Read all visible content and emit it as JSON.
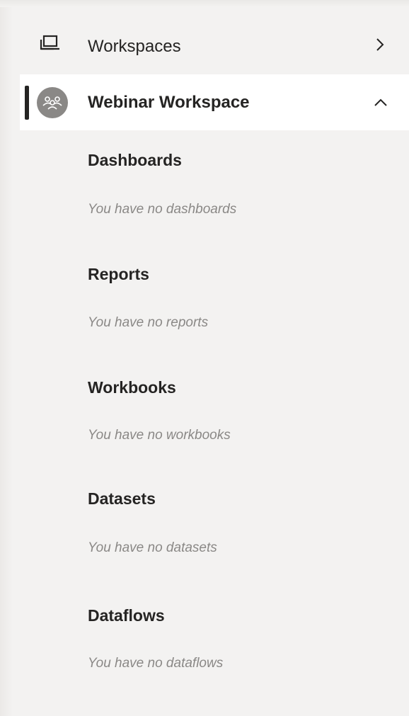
{
  "nav": {
    "workspaces": {
      "label": "Workspaces",
      "icon": "workspaces-icon",
      "chevron": "chevron-right-icon"
    },
    "current_workspace": {
      "label": "Webinar Workspace",
      "icon": "group-avatar-icon",
      "chevron": "chevron-up-icon",
      "active": true
    }
  },
  "sections": [
    {
      "title": "Dashboards",
      "empty_text": "You have no dashboards"
    },
    {
      "title": "Reports",
      "empty_text": "You have no reports"
    },
    {
      "title": "Workbooks",
      "empty_text": "You have no workbooks"
    },
    {
      "title": "Datasets",
      "empty_text": "You have no datasets"
    },
    {
      "title": "Dataflows",
      "empty_text": "You have no dataflows"
    }
  ],
  "colors": {
    "pane_background": "#f3f2f1",
    "selected_background": "#ffffff",
    "active_indicator": "#252423",
    "text_primary": "#252423",
    "text_muted": "#8a8886",
    "avatar_background": "#8a8886"
  }
}
